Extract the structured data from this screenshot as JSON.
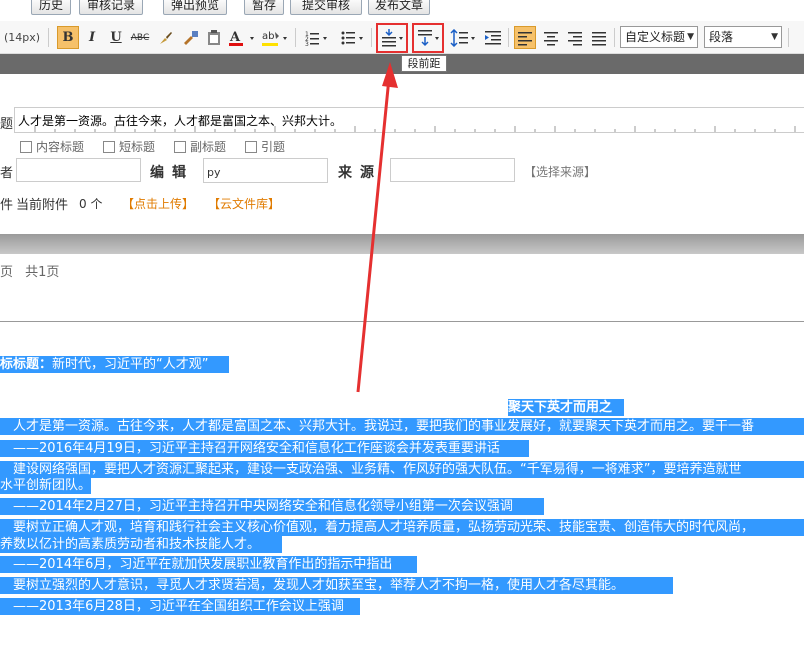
{
  "top_buttons": [
    "历史",
    "审核记录",
    "弹出预览",
    "暂存",
    "提交审核",
    "发布文章"
  ],
  "toolbar": {
    "font_size": "(14px)",
    "bold": "B",
    "italic": "I",
    "underline": "U",
    "strike": "ABC",
    "custom_heading": "自定义标题",
    "paragraph": "段落",
    "tooltip": "段前距"
  },
  "form": {
    "title_label_cut": "题",
    "title_value": "人才是第一资源。古往今来，人才都是富国之本、兴邦大计。",
    "checkboxes": [
      "内容标题",
      "短标题",
      "副标题",
      "引题"
    ],
    "author_label_cut": "者",
    "editor_label": "编辑",
    "editor_value": "py",
    "source_label": "来源",
    "choose_source": "【选择来源】",
    "attach_label_cut": "件",
    "attach_text": "当前附件",
    "attach_count": "0 个",
    "upload_link": "【点击上传】",
    "cloud_link": "【云文件库】"
  },
  "pager": {
    "text_a": "页",
    "text_b": "共1页"
  },
  "content": {
    "subtitle_label": "标标题：",
    "subtitle_value": "新时代，习近平的“人才观”",
    "heading": "聚天下英才而用之",
    "lines": [
      "　人才是第一资源。古往今来，人才都是富国之本、兴邦大计。我说过，要把我们的事业发展好，就要聚天下英才而用之。要干一番",
      "　——2016年4月19日，习近平主持召开网络安全和信息化工作座谈会并发表重要讲话",
      "　建设网络强国，要把人才资源汇聚起来，建设一支政治强、业务精、作风好的强大队伍。“千军易得，一将难求”，要培养造就世",
      "水平创新团队。",
      "　——2014年2月27日，习近平主持召开中央网络安全和信息化领导小组第一次会议强调",
      "　要树立正确人才观，培育和践行社会主义核心价值观，着力提高人才培养质量，弘扬劳动光荣、技能宝贵、创造伟大的时代风尚，",
      "养数以亿计的高素质劳动者和技术技能人才。",
      "　——2014年6月，习近平在就加快发展职业教育作出的指示中指出",
      "　要树立强烈的人才意识，寻觅人才求贤若渴，发现人才如获至宝，举荐人才不拘一格，使用人才各尽其能。",
      "　——2013年6月28日，习近平在全国组织工作会议上强调"
    ]
  },
  "colors": {
    "selection": "#3399ff",
    "highlight_box": "#e53030",
    "bold_active": "#f6c16a",
    "link_orange": "#e07b00"
  }
}
